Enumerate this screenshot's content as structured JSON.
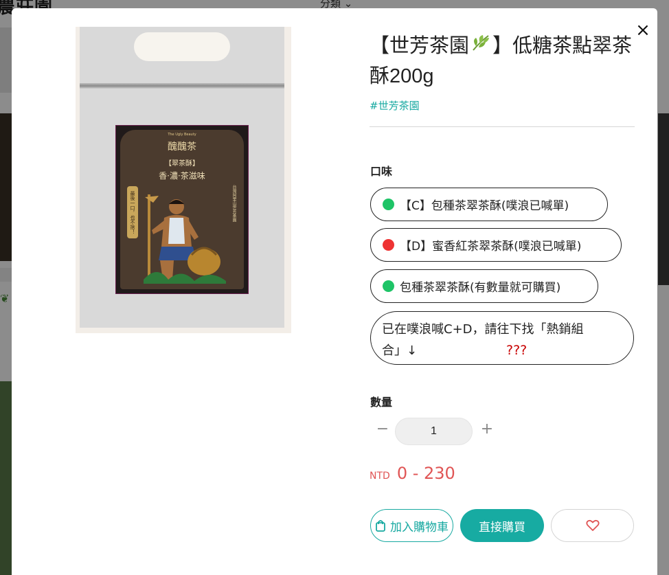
{
  "background": {
    "store_title": "農莊園",
    "category_label": "分類 ⌄"
  },
  "product": {
    "title_part1": "【世芳茶園",
    "title_part2": "】低糖茶點翠茶酥200g",
    "tag": "#世芳茶園",
    "image_label": {
      "brand": "The Ugly Beauty",
      "name": "醜醜茶",
      "subtitle": "【翠茶酥】",
      "slogan": "香·濃·茶滋味",
      "side_tag": "最後一口，也不捨！",
      "vertical_text": "台灣阿里山世芳茶園"
    }
  },
  "flavor": {
    "label": "口味",
    "options": [
      {
        "text": "【C】包種茶翠茶酥(噗浪已喊單)",
        "dot_color": "#1ec467"
      },
      {
        "text": "【D】蜜香紅茶翠茶酥(噗浪已喊單)",
        "dot_color": "#ee3333"
      },
      {
        "text": "包種茶翠茶酥(有數量就可購買)",
        "dot_color": "#1ec467"
      }
    ],
    "note_line1": "已在噗浪喊C+D，請往下找「熱銷組",
    "note_line2": "合」↓",
    "note_mark": "???"
  },
  "quantity": {
    "label": "數量",
    "value": "1",
    "minus": "−",
    "plus": "+"
  },
  "price": {
    "currency": "NTD",
    "range": "0 - 230"
  },
  "actions": {
    "add_to_cart": "加入購物車",
    "buy_now": "直接購買"
  },
  "colors": {
    "accent": "#17a9a1",
    "price": "#e05555"
  }
}
